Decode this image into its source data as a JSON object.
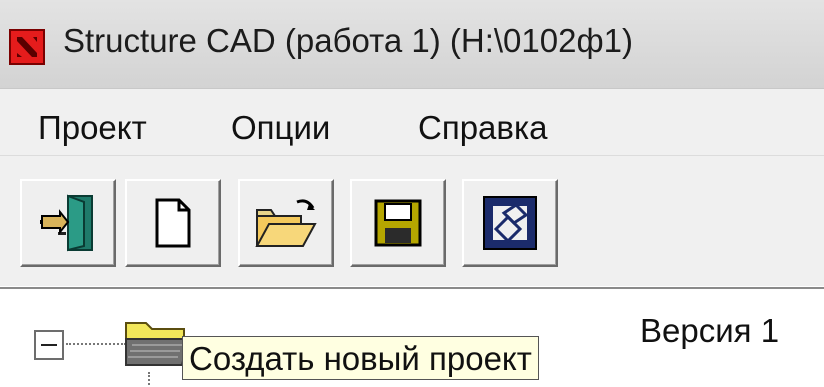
{
  "window": {
    "title": "Structure CAD (работа 1) (H:\\0102ф1)",
    "icon": "structure-cad-app-icon"
  },
  "menu": {
    "items": [
      "Проект",
      "Опции",
      "Справка"
    ]
  },
  "toolbar": {
    "buttons": [
      {
        "name": "exit",
        "icon": "exit-door-icon"
      },
      {
        "name": "new",
        "icon": "new-document-icon"
      },
      {
        "name": "open",
        "icon": "open-folder-icon"
      },
      {
        "name": "save",
        "icon": "save-floppy-icon"
      },
      {
        "name": "model",
        "icon": "model-view-icon"
      }
    ]
  },
  "tree": {
    "root_label_visible": "Версия 1",
    "root_icon": "folder-icon"
  },
  "tooltip": {
    "text": "Создать новый проект"
  },
  "colors": {
    "app_icon": "#e51c1c",
    "tooltip_bg": "#ffffe1",
    "save_icon": "#b5a600"
  }
}
